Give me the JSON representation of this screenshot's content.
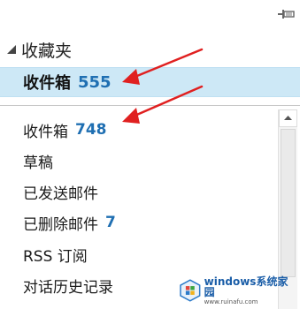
{
  "favorites": {
    "title": "收藏夹",
    "inbox": {
      "label": "收件箱",
      "count": "555"
    }
  },
  "folders": [
    {
      "label": "收件箱",
      "count": "748"
    },
    {
      "label": "草稿",
      "count": ""
    },
    {
      "label": "已发送邮件",
      "count": ""
    },
    {
      "label": "已删除邮件",
      "count": "7"
    },
    {
      "label": "RSS 订阅",
      "count": ""
    },
    {
      "label": "对话历史记录",
      "count": ""
    }
  ],
  "colors": {
    "accent_count": "#1f6fb2",
    "selected_bg": "#cde8f6",
    "annotation_arrow": "#e02020"
  },
  "watermark": {
    "title": "windows系统家园",
    "url": "www.ruinafu.com"
  }
}
